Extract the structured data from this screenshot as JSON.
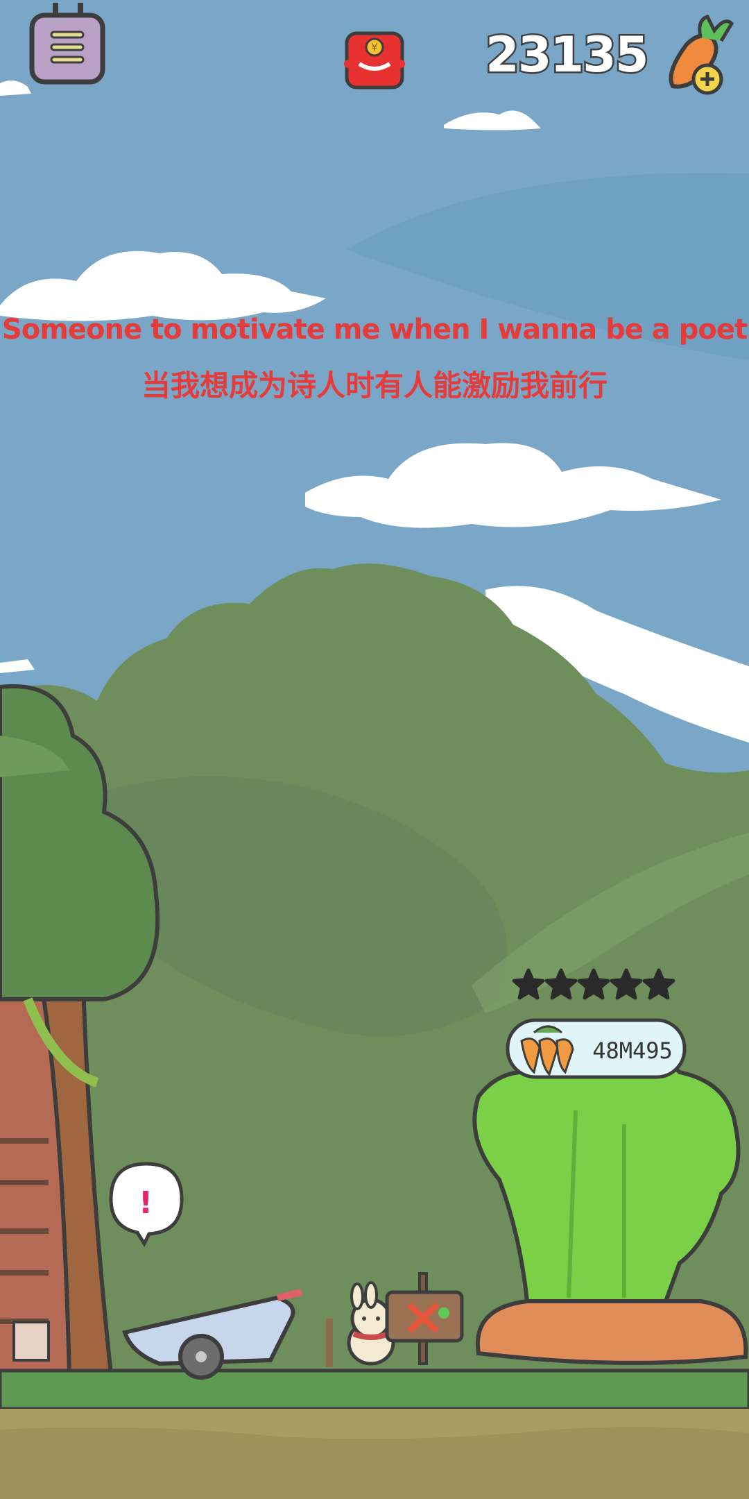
{
  "hud": {
    "menu_icon": "menu-list-icon",
    "red_packet_icon": "red-packet-icon",
    "score": "23135",
    "add_carrot_icon": "carrot-plus-icon"
  },
  "caption": {
    "english": "Someone to motivate me when I wanna be a poet",
    "chinese": "当我想成为诗人时有人能激励我前行"
  },
  "plant": {
    "stars": 5,
    "stars_filled": 0,
    "carrot_count": "48M495"
  },
  "scene": {
    "alert_mark": "!",
    "sky_color": "#7aa7c7",
    "forest_color": "#6e8f5c",
    "grass_color": "#5f9a52",
    "ground_color": "#a89e63"
  }
}
